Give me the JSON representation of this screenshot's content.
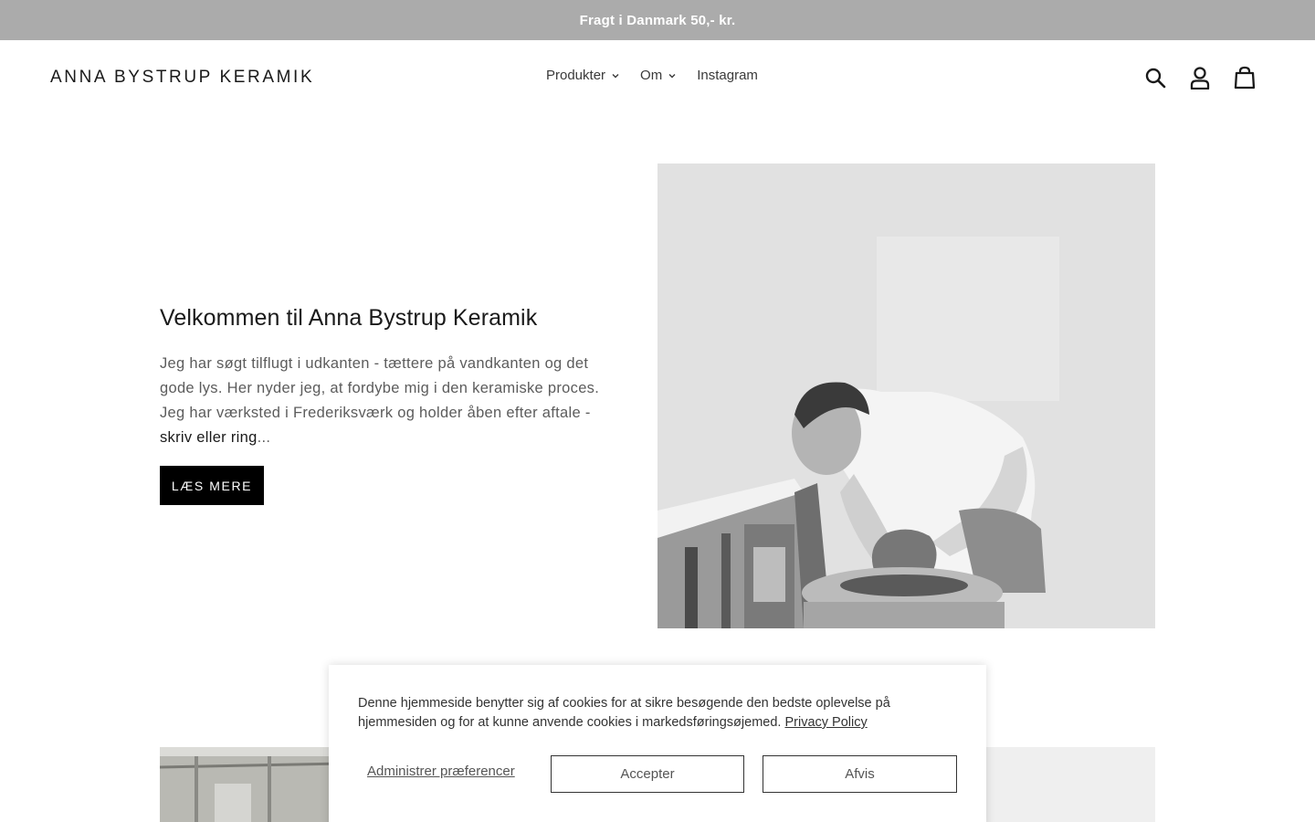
{
  "announcement": {
    "text": "Fragt i Danmark 50,- kr."
  },
  "header": {
    "logo": "ANNA BYSTRUP KERAMIK",
    "nav": [
      {
        "label": "Produkter",
        "has_dropdown": true
      },
      {
        "label": "Om",
        "has_dropdown": true
      },
      {
        "label": "Instagram",
        "has_dropdown": false
      }
    ],
    "icons": [
      "search-icon",
      "account-icon",
      "cart-icon"
    ]
  },
  "hero": {
    "title": "Velkommen til Anna Bystrup Keramik",
    "body": "Jeg har søgt tilflugt i udkanten - tættere på vandkanten og det gode lys. Her nyder jeg, at fordybe mig i den keramiske proces. Jeg har værksted i Frederiksværk og holder åben efter aftale - ",
    "link_text": "skriv eller ring",
    "ellipsis": "...",
    "button_label": "LÆS MERE"
  },
  "cookie_banner": {
    "text": "Denne hjemmeside benytter sig af cookies for at sikre besøgende den bedste oplevelse på hjemmesiden og for at kunne anvende cookies i markedsføringsøjemed. ",
    "policy_link": "Privacy Policy",
    "manage_label": "Administrer præferencer",
    "accept_label": "Accepter",
    "reject_label": "Afvis"
  },
  "colors": {
    "announcement_bg": "#ababab",
    "button_bg": "#000000",
    "text": "#1a1a1a"
  }
}
